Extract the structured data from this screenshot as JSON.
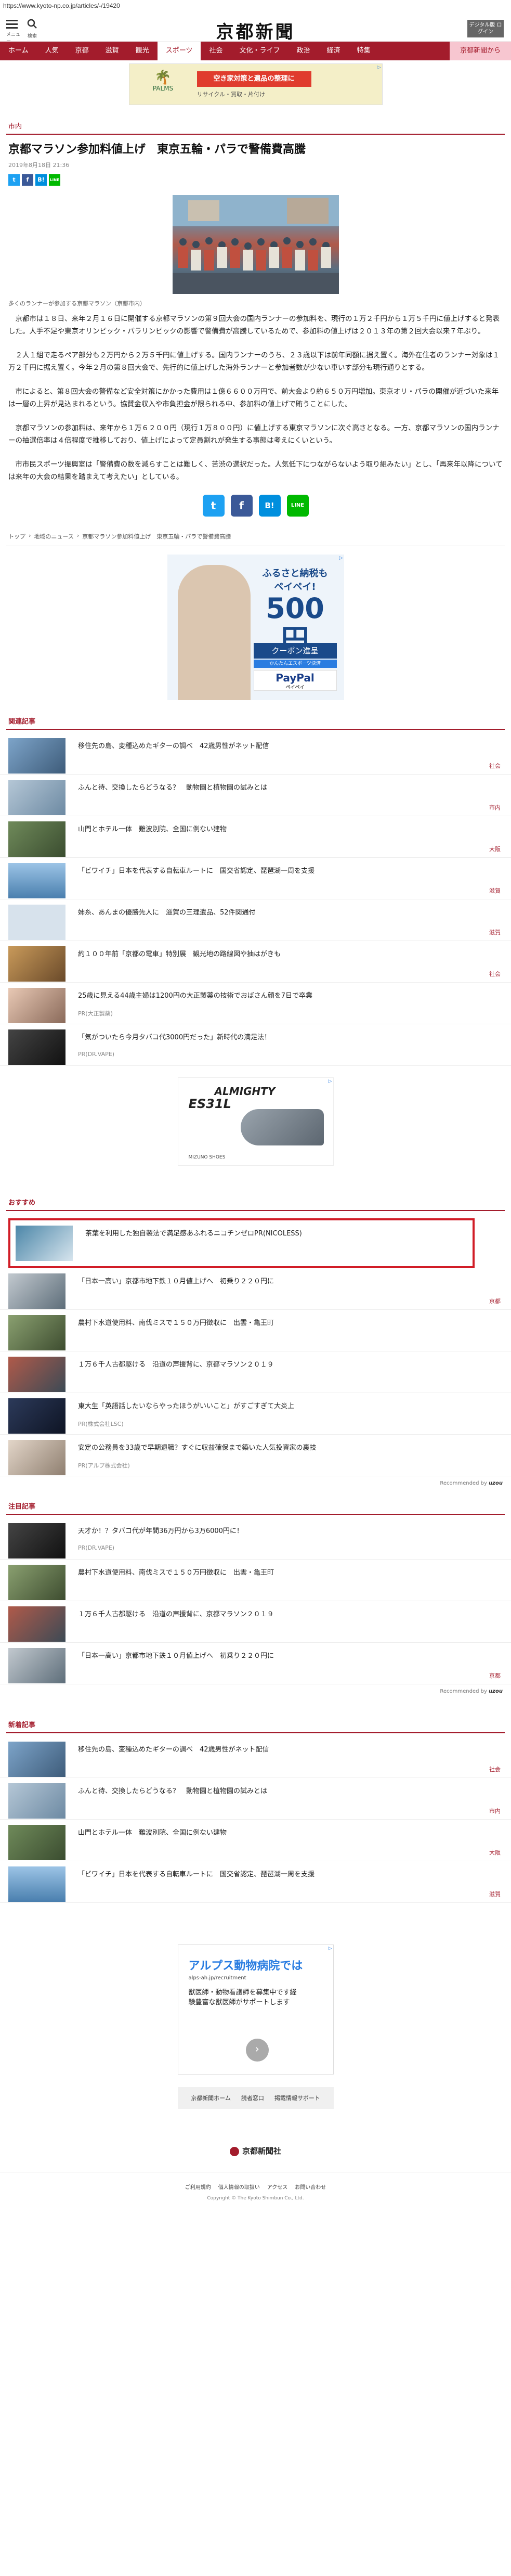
{
  "url": "https://www.kyoto-np.co.jp/articles/-/19420",
  "header": {
    "menu_label": "メニュー",
    "search_label": "検索",
    "logo": "京都新聞",
    "digital_label": "デジタル版 ログイン"
  },
  "nav": [
    "ホーム",
    "人気",
    "京都",
    "滋賀",
    "観光",
    "スポーツ",
    "社会",
    "文化・ライフ",
    "政治",
    "経済",
    "特集",
    "京都新聞から"
  ],
  "nav_active": "スポーツ",
  "top_ad": {
    "brand": "PALMS",
    "headline": "空き家対策と遺品の整理に",
    "sub": "リサイクル・買取・片付け"
  },
  "article": {
    "section": "市内",
    "headline": "京都マラソン参加料値上げ　東京五輪・パラで警備費高騰",
    "date": "2019年8月18日 21:36",
    "caption": "多くのランナーが参加する京都マラソン（京都市内）",
    "paragraphs": [
      "京都市は１８日、来年２月１６日に開催する京都マラソンの第９回大会の国内ランナーの参加料を、現行の１万２千円から１万５千円に値上げすると発表した。人手不足や東京オリンピック・パラリンピックの影響で警備費が高騰しているためで、参加料の値上げは２０１３年の第２回大会以来７年ぶり。",
      "２人１組で走るペア部分も２万円から２万５千円に値上げする。国内ランナーのうち、２３歳以下は前年同額に据え置く。海外在住者のランナー対象は１万２千円に据え置く。今年２月の第８回大会で、先行的に値上げした海外ランナーと参加者数が少ない車いす部分も現行通りとする。",
      "市によると、第８回大会の警備など安全対策にかかった費用は１億６６００万円で、前大会より約６５０万円増加。東京オリ・パラの開催が近づいた来年は一層の上昇が見込まれるという。協賛金収入や市負担金が限られる中、参加料の値上げで賄うことにした。",
      "京都マラソンの参加料は、来年から１万６２００円（現行１万８００円）に値上げする東京マラソンに次ぐ高さとなる。一方、京都マラソンの国内ランナーの抽選倍率は４倍程度で推移しており、値上げによって定員割れが発生する事態は考えにくいという。",
      "市市民スポーツ振興室は「警備費の数を減らすことは難しく、苦渋の選択だった。人気低下につながらないよう取り組みたい」とし、「再来年以降については来年の大会の結果を踏まえて考えたい」としている。"
    ]
  },
  "share": {
    "tw": "t",
    "fb": "f",
    "hb": "B!",
    "line": "LINE"
  },
  "breadcrumb": [
    "トップ",
    "地域のニュース",
    "京都マラソン参加料値上げ　東京五輪・パラで警備費高騰"
  ],
  "square_ad": {
    "t1": "ふるさと納税も",
    "t2": "ペイペイ!",
    "num": "500円",
    "coupon": "クーポン進呈",
    "strip": "かんたんエスポーツ決済",
    "paypal": "PayPal",
    "paypal_sub": "ペイペイ"
  },
  "related_title": "関連記事",
  "related": [
    {
      "text": "移住先の島、変種込めたギターの調べ　42歳男性がネット配信",
      "cat": "社会"
    },
    {
      "text": "ふんと待、交換したらどうなる？　動物園と植物園の試みとは",
      "cat": "市内"
    },
    {
      "text": "山門とホテル一体　難波別院、全国に例ない建物",
      "cat": "大阪"
    },
    {
      "text": "「ビワイチ」日本を代表する自転車ルートに　国交省認定、琵琶湖一周を支援",
      "cat": "滋賀"
    },
    {
      "text": "姉糸、あんまの優勝先人に　滋賀の三理遺品、52件関通付",
      "cat": "滋賀"
    },
    {
      "text": "約１００年前「京都の電車」特別展　観光地の路線図や抽はがきも",
      "cat": "社会"
    }
  ],
  "pr_items": [
    {
      "text": "25歳に見える44歳主婦は1200円の大正製薬の技術でおばさん顔を7日で卒業",
      "pr": "PR(大正製薬)"
    },
    {
      "text": "「気がついたら今月タバコ代3000円だった」新時代の満足法！",
      "pr": "PR(DR.VAPE)"
    }
  ],
  "shoe_ad": {
    "brand": "ALMIGHTY",
    "model": "ES31L",
    "tag": "MIZUNO SHOES"
  },
  "recommend_title": "おすすめ",
  "recommend": [
    {
      "text": "茶葉を利用した独自製法で満足感あふれるニコチンゼロ",
      "pr": "PR(NICOLESS)"
    },
    {
      "text": "「日本一高い」京都市地下鉄１０月値上げへ　初乗り２２０円に",
      "cat": "京都"
    },
    {
      "text": "農村下水道使用料、南伐ミスで１５０万円徴収に　出雲・亀王町",
      "cat": ""
    },
    {
      "text": "１万６千人古都駆ける　沿道の声援背に、京都マラソン２０１９",
      "cat": ""
    },
    {
      "text": "東大生「英語話したいならやったほうがいいこと」がすごすぎて大炎上",
      "pr": "PR(株式会社LSC)"
    },
    {
      "text": "安定の公務員を33歳で早期退職？すぐに収益確保まで築いた人気投資家の裏技",
      "pr": "PR(アルプ株式会社)"
    }
  ],
  "recommended_by": "Recommended by",
  "uzou": "uzou",
  "attention_title": "注目記事",
  "attention": [
    {
      "text": "天才か！？タバコ代が年間36万円から3万6000円に！",
      "pr": "PR(DR.VAPE)"
    },
    {
      "text": "農村下水道使用料、南伐ミスで１５０万円徴収に　出雲・亀王町",
      "cat": ""
    },
    {
      "text": "１万６千人古都駆ける　沿道の声援背に、京都マラソン２０１９",
      "cat": ""
    },
    {
      "text": "「日本一高い」京都市地下鉄１０月値上げへ　初乗り２２０円に",
      "cat": "京都"
    }
  ],
  "new_title": "新着記事",
  "new_items": [
    {
      "text": "移住先の島、変種込めたギターの調べ　42歳男性がネット配信",
      "cat": "社会"
    },
    {
      "text": "ふんと待、交換したらどうなる？　動物園と植物園の試みとは",
      "cat": "市内"
    },
    {
      "text": "山門とホテル一体　難波別院、全国に例ない建物",
      "cat": "大阪"
    },
    {
      "text": "「ビワイチ」日本を代表する自転車ルートに　国交省認定、琵琶湖一周を支援",
      "cat": "滋賀"
    }
  ],
  "hospital_ad": {
    "t1": "アルプス動物病院では",
    "t2": "alps-ah.jp/recruitment",
    "t3": "獣医師・動物看護師を募集中です経験豊富な獣医師がサポートします"
  },
  "foot_links": [
    "京都新聞ホーム",
    "読者窓口",
    "掲載情報サポート"
  ],
  "footer_logo": "京都新聞社",
  "footer_nav": [
    "ご利用規約",
    "個人情報の取扱い",
    "アクセス",
    "お問い合わせ"
  ],
  "copyright": "Copyright © The Kyoto Shimbun Co., Ltd."
}
